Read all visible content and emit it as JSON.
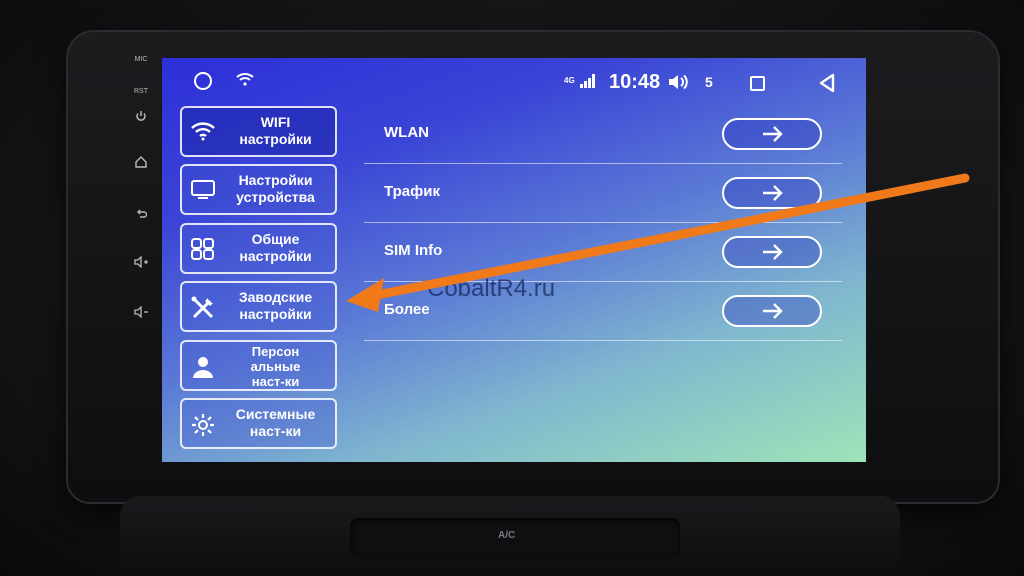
{
  "side_buttons": [
    {
      "label": "MIC",
      "icon": "mic-label"
    },
    {
      "label": "RST",
      "icon": "reset-label"
    },
    {
      "label": "",
      "icon": "power-icon"
    },
    {
      "label": "",
      "icon": "home-icon"
    },
    {
      "label": "",
      "icon": "back-icon"
    },
    {
      "label": "",
      "icon": "volume-up-icon"
    },
    {
      "label": "",
      "icon": "volume-down-icon"
    }
  ],
  "status_bar": {
    "signal_type": "4G",
    "time": "10:48",
    "volume_level": "5"
  },
  "menu": [
    {
      "label": "WIFI настройки",
      "line1": "WIFI",
      "line2": "настройки",
      "icon": "wifi-icon",
      "active": true
    },
    {
      "label": "Настройки устройства",
      "line1": "Настройки",
      "line2": "устройства",
      "icon": "device-icon",
      "active": false
    },
    {
      "label": "Общие настройки",
      "line1": "Общие",
      "line2": "настройки",
      "icon": "grid-icon",
      "active": false
    },
    {
      "label": "Заводские настройки",
      "line1": "Заводские",
      "line2": "настройки",
      "icon": "tools-icon",
      "active": false
    },
    {
      "label": "Персональные наст-ки",
      "line1": "Персон",
      "line2": "альные",
      "line3": "наст-ки",
      "icon": "person-icon",
      "active": false
    },
    {
      "label": "Системные наст-ки",
      "line1": "Системные",
      "line2": "наст-ки",
      "icon": "gear-icon",
      "active": false
    }
  ],
  "list": [
    {
      "label": "WLAN"
    },
    {
      "label": "Трафик"
    },
    {
      "label": "SIM Info"
    },
    {
      "label": "Более"
    }
  ],
  "watermark": "CobaltR4.ru",
  "console": {
    "label": "A/C"
  },
  "colors": {
    "accent_arrow": "#f07a1a",
    "screen_top": "#2d2fd8",
    "screen_bottom": "#9fe3b8"
  }
}
